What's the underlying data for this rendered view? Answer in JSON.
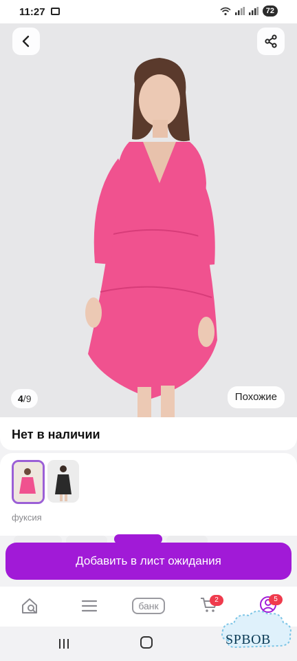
{
  "status_bar": {
    "time": "11:27",
    "battery": "72",
    "icons": [
      "screen-record-icon",
      "wifi-icon",
      "signal-icon",
      "signal-icon"
    ]
  },
  "gallery": {
    "counter_current": "4",
    "counter_total": "9",
    "similar_label": "Похожие",
    "back_icon": "chevron-left-icon",
    "share_icon": "share-icon",
    "product_color": "#f0528f"
  },
  "availability": {
    "text": "Нет в наличии"
  },
  "variants": {
    "selected_color_label": "фуксия",
    "thumbnails": [
      "pink-dress-thumb",
      "black-dress-thumb"
    ],
    "accent": "#9b5fd6"
  },
  "cta": {
    "label": "Добавить в лист ожидания",
    "color": "#a11ad7"
  },
  "tab_bar": {
    "bank_label": "банк",
    "cart_badge": "2",
    "profile_badge": "5",
    "icons": [
      "home-search-icon",
      "catalog-icon",
      "bank-icon",
      "cart-icon",
      "profile-icon"
    ]
  },
  "watermark": {
    "text": "SPBOB"
  }
}
